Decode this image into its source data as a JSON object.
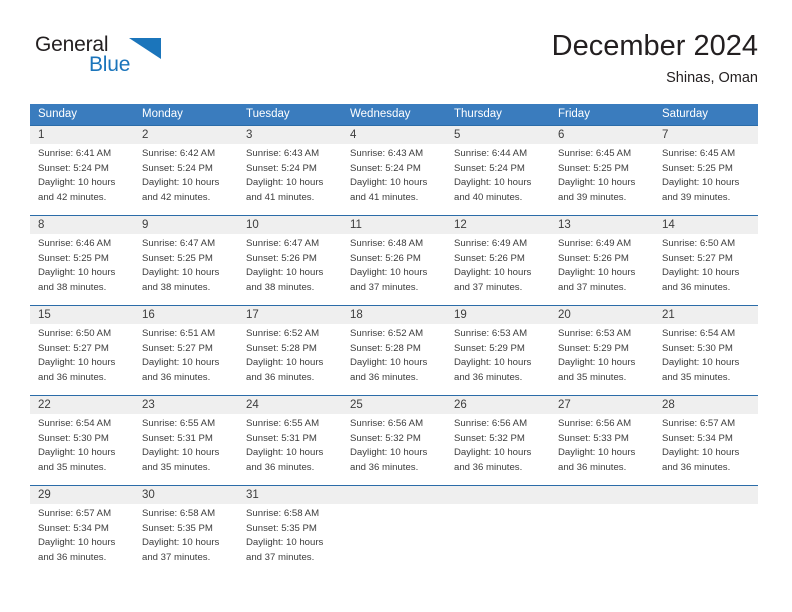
{
  "brand": {
    "name_part1": "General",
    "name_part2": "Blue",
    "accent_color": "#1b75bb",
    "triangle_icon": "triangle-icon"
  },
  "header": {
    "title": "December 2024",
    "subtitle": "Shinas, Oman"
  },
  "calendar": {
    "header_color": "#3a7cbe",
    "border_color": "#2b6ca8",
    "daynum_band_color": "#efefef",
    "weekdays": [
      "Sunday",
      "Monday",
      "Tuesday",
      "Wednesday",
      "Thursday",
      "Friday",
      "Saturday"
    ],
    "weeks": [
      [
        {
          "day": "1",
          "sunrise": "Sunrise: 6:41 AM",
          "sunset": "Sunset: 5:24 PM",
          "daylight1": "Daylight: 10 hours",
          "daylight2": "and 42 minutes."
        },
        {
          "day": "2",
          "sunrise": "Sunrise: 6:42 AM",
          "sunset": "Sunset: 5:24 PM",
          "daylight1": "Daylight: 10 hours",
          "daylight2": "and 42 minutes."
        },
        {
          "day": "3",
          "sunrise": "Sunrise: 6:43 AM",
          "sunset": "Sunset: 5:24 PM",
          "daylight1": "Daylight: 10 hours",
          "daylight2": "and 41 minutes."
        },
        {
          "day": "4",
          "sunrise": "Sunrise: 6:43 AM",
          "sunset": "Sunset: 5:24 PM",
          "daylight1": "Daylight: 10 hours",
          "daylight2": "and 41 minutes."
        },
        {
          "day": "5",
          "sunrise": "Sunrise: 6:44 AM",
          "sunset": "Sunset: 5:24 PM",
          "daylight1": "Daylight: 10 hours",
          "daylight2": "and 40 minutes."
        },
        {
          "day": "6",
          "sunrise": "Sunrise: 6:45 AM",
          "sunset": "Sunset: 5:25 PM",
          "daylight1": "Daylight: 10 hours",
          "daylight2": "and 39 minutes."
        },
        {
          "day": "7",
          "sunrise": "Sunrise: 6:45 AM",
          "sunset": "Sunset: 5:25 PM",
          "daylight1": "Daylight: 10 hours",
          "daylight2": "and 39 minutes."
        }
      ],
      [
        {
          "day": "8",
          "sunrise": "Sunrise: 6:46 AM",
          "sunset": "Sunset: 5:25 PM",
          "daylight1": "Daylight: 10 hours",
          "daylight2": "and 38 minutes."
        },
        {
          "day": "9",
          "sunrise": "Sunrise: 6:47 AM",
          "sunset": "Sunset: 5:25 PM",
          "daylight1": "Daylight: 10 hours",
          "daylight2": "and 38 minutes."
        },
        {
          "day": "10",
          "sunrise": "Sunrise: 6:47 AM",
          "sunset": "Sunset: 5:26 PM",
          "daylight1": "Daylight: 10 hours",
          "daylight2": "and 38 minutes."
        },
        {
          "day": "11",
          "sunrise": "Sunrise: 6:48 AM",
          "sunset": "Sunset: 5:26 PM",
          "daylight1": "Daylight: 10 hours",
          "daylight2": "and 37 minutes."
        },
        {
          "day": "12",
          "sunrise": "Sunrise: 6:49 AM",
          "sunset": "Sunset: 5:26 PM",
          "daylight1": "Daylight: 10 hours",
          "daylight2": "and 37 minutes."
        },
        {
          "day": "13",
          "sunrise": "Sunrise: 6:49 AM",
          "sunset": "Sunset: 5:26 PM",
          "daylight1": "Daylight: 10 hours",
          "daylight2": "and 37 minutes."
        },
        {
          "day": "14",
          "sunrise": "Sunrise: 6:50 AM",
          "sunset": "Sunset: 5:27 PM",
          "daylight1": "Daylight: 10 hours",
          "daylight2": "and 36 minutes."
        }
      ],
      [
        {
          "day": "15",
          "sunrise": "Sunrise: 6:50 AM",
          "sunset": "Sunset: 5:27 PM",
          "daylight1": "Daylight: 10 hours",
          "daylight2": "and 36 minutes."
        },
        {
          "day": "16",
          "sunrise": "Sunrise: 6:51 AM",
          "sunset": "Sunset: 5:27 PM",
          "daylight1": "Daylight: 10 hours",
          "daylight2": "and 36 minutes."
        },
        {
          "day": "17",
          "sunrise": "Sunrise: 6:52 AM",
          "sunset": "Sunset: 5:28 PM",
          "daylight1": "Daylight: 10 hours",
          "daylight2": "and 36 minutes."
        },
        {
          "day": "18",
          "sunrise": "Sunrise: 6:52 AM",
          "sunset": "Sunset: 5:28 PM",
          "daylight1": "Daylight: 10 hours",
          "daylight2": "and 36 minutes."
        },
        {
          "day": "19",
          "sunrise": "Sunrise: 6:53 AM",
          "sunset": "Sunset: 5:29 PM",
          "daylight1": "Daylight: 10 hours",
          "daylight2": "and 36 minutes."
        },
        {
          "day": "20",
          "sunrise": "Sunrise: 6:53 AM",
          "sunset": "Sunset: 5:29 PM",
          "daylight1": "Daylight: 10 hours",
          "daylight2": "and 35 minutes."
        },
        {
          "day": "21",
          "sunrise": "Sunrise: 6:54 AM",
          "sunset": "Sunset: 5:30 PM",
          "daylight1": "Daylight: 10 hours",
          "daylight2": "and 35 minutes."
        }
      ],
      [
        {
          "day": "22",
          "sunrise": "Sunrise: 6:54 AM",
          "sunset": "Sunset: 5:30 PM",
          "daylight1": "Daylight: 10 hours",
          "daylight2": "and 35 minutes."
        },
        {
          "day": "23",
          "sunrise": "Sunrise: 6:55 AM",
          "sunset": "Sunset: 5:31 PM",
          "daylight1": "Daylight: 10 hours",
          "daylight2": "and 35 minutes."
        },
        {
          "day": "24",
          "sunrise": "Sunrise: 6:55 AM",
          "sunset": "Sunset: 5:31 PM",
          "daylight1": "Daylight: 10 hours",
          "daylight2": "and 36 minutes."
        },
        {
          "day": "25",
          "sunrise": "Sunrise: 6:56 AM",
          "sunset": "Sunset: 5:32 PM",
          "daylight1": "Daylight: 10 hours",
          "daylight2": "and 36 minutes."
        },
        {
          "day": "26",
          "sunrise": "Sunrise: 6:56 AM",
          "sunset": "Sunset: 5:32 PM",
          "daylight1": "Daylight: 10 hours",
          "daylight2": "and 36 minutes."
        },
        {
          "day": "27",
          "sunrise": "Sunrise: 6:56 AM",
          "sunset": "Sunset: 5:33 PM",
          "daylight1": "Daylight: 10 hours",
          "daylight2": "and 36 minutes."
        },
        {
          "day": "28",
          "sunrise": "Sunrise: 6:57 AM",
          "sunset": "Sunset: 5:34 PM",
          "daylight1": "Daylight: 10 hours",
          "daylight2": "and 36 minutes."
        }
      ],
      [
        {
          "day": "29",
          "sunrise": "Sunrise: 6:57 AM",
          "sunset": "Sunset: 5:34 PM",
          "daylight1": "Daylight: 10 hours",
          "daylight2": "and 36 minutes."
        },
        {
          "day": "30",
          "sunrise": "Sunrise: 6:58 AM",
          "sunset": "Sunset: 5:35 PM",
          "daylight1": "Daylight: 10 hours",
          "daylight2": "and 37 minutes."
        },
        {
          "day": "31",
          "sunrise": "Sunrise: 6:58 AM",
          "sunset": "Sunset: 5:35 PM",
          "daylight1": "Daylight: 10 hours",
          "daylight2": "and 37 minutes."
        },
        {
          "day": "",
          "sunrise": "",
          "sunset": "",
          "daylight1": "",
          "daylight2": ""
        },
        {
          "day": "",
          "sunrise": "",
          "sunset": "",
          "daylight1": "",
          "daylight2": ""
        },
        {
          "day": "",
          "sunrise": "",
          "sunset": "",
          "daylight1": "",
          "daylight2": ""
        },
        {
          "day": "",
          "sunrise": "",
          "sunset": "",
          "daylight1": "",
          "daylight2": ""
        }
      ]
    ]
  }
}
